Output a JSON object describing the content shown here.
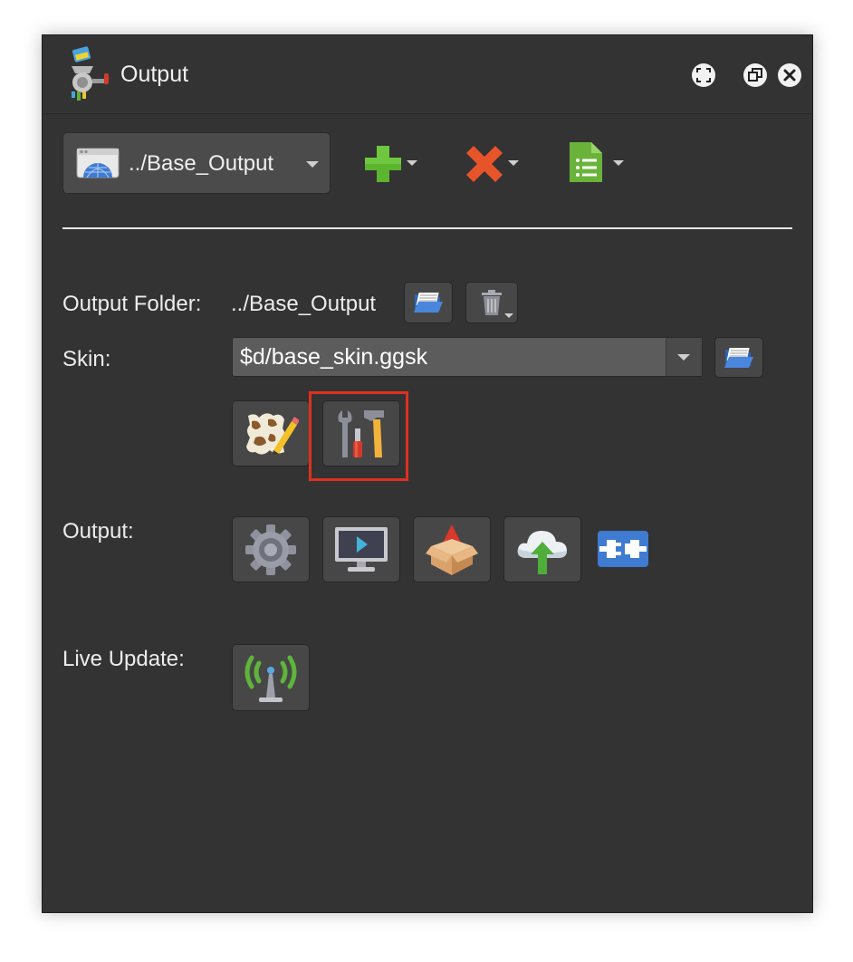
{
  "window": {
    "title": "Output",
    "buttons": [
      "fullscreen-icon",
      "restore-icon",
      "close-icon"
    ]
  },
  "toolbar": {
    "output_select_value": "../Base_Output",
    "buttons": [
      {
        "name": "add-output",
        "icon": "green-plus-icon",
        "color": "#5cb52e"
      },
      {
        "name": "remove-output",
        "icon": "red-x-icon",
        "color": "#e8542a"
      },
      {
        "name": "output-list",
        "icon": "green-document-list-icon",
        "color": "#6ab33a"
      }
    ]
  },
  "form": {
    "output_folder_label": "Output Folder:",
    "output_folder_value": "../Base_Output",
    "skin_label": "Skin:",
    "skin_value": "$d/base_skin.ggsk",
    "output_label": "Output:",
    "live_update_label": "Live Update:"
  },
  "icons": {
    "skin_buttons": [
      "skin-editor-icon",
      "tools-icon"
    ],
    "output_buttons": [
      "gear-icon",
      "monitor-play-icon",
      "package-gnome-icon",
      "cloud-upload-icon",
      "plugin-icon"
    ],
    "live_update_button": "antenna-icon"
  },
  "colors": {
    "panel_bg": "#333333",
    "button_bg": "#474747",
    "highlight": "#e0301e",
    "accent_blue": "#3e7bd1"
  }
}
